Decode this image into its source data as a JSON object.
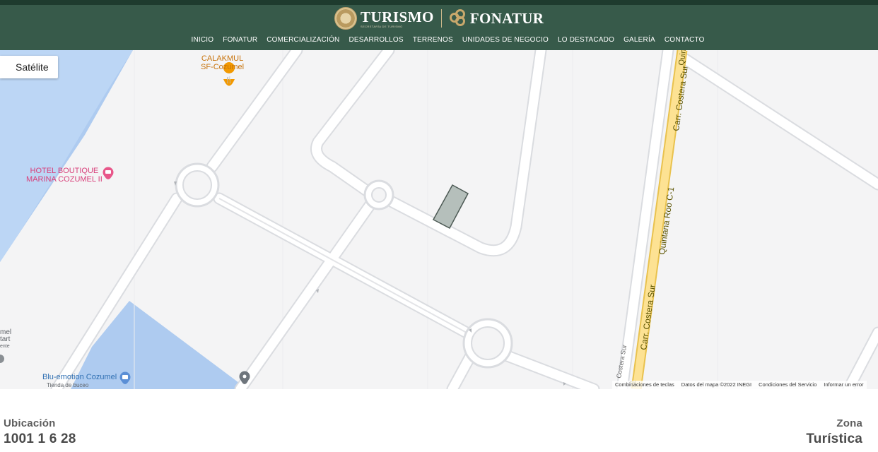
{
  "header": {
    "brand_turismo": "TURISMO",
    "brand_turismo_sub": "SECRETARÍA DE TURISMO",
    "brand_fonatur": "FONATUR",
    "nav": [
      "INICIO",
      "FONATUR",
      "COMERCIALIZACIÓN",
      "DESARROLLOS",
      "TERRENOS",
      "UNIDADES DE NEGOCIO",
      "LO DESTACADO",
      "GALERÍA",
      "CONTACTO"
    ]
  },
  "map": {
    "satellite_button": "Satélite",
    "labels": {
      "poi_calakmul_1": "CALAKMUL",
      "poi_calakmul_2": "SF-Cozumel",
      "poi_hotel_1": "HOTEL BOUTIQUE",
      "poi_hotel_2": "MARINA COZUMEL II",
      "poi_blu_1": "Blu-emotion Cozumel",
      "poi_blu_2": "Tienda de buceo",
      "poi_cut_1": "mel",
      "poi_cut_2": "tart",
      "poi_cut_3": "ente",
      "road_costera_1": "Carr. Costera Sur",
      "road_costera_2": "Carr. Costera Sur",
      "road_costera_3": "Costera Sur",
      "road_qroo": "Quintana Roo C-1",
      "road_qui": "Quin",
      "road_c1": "-1"
    },
    "attribution": [
      "Combinaciones de teclas",
      "Datos del mapa ©2022 INEGI",
      "Condiciones del Servicio",
      "Informar un error"
    ]
  },
  "info": {
    "location_label": "Ubicación",
    "location_value": "1001 1 6 28",
    "zone_label": "Zona",
    "zone_value": "Turística"
  }
}
